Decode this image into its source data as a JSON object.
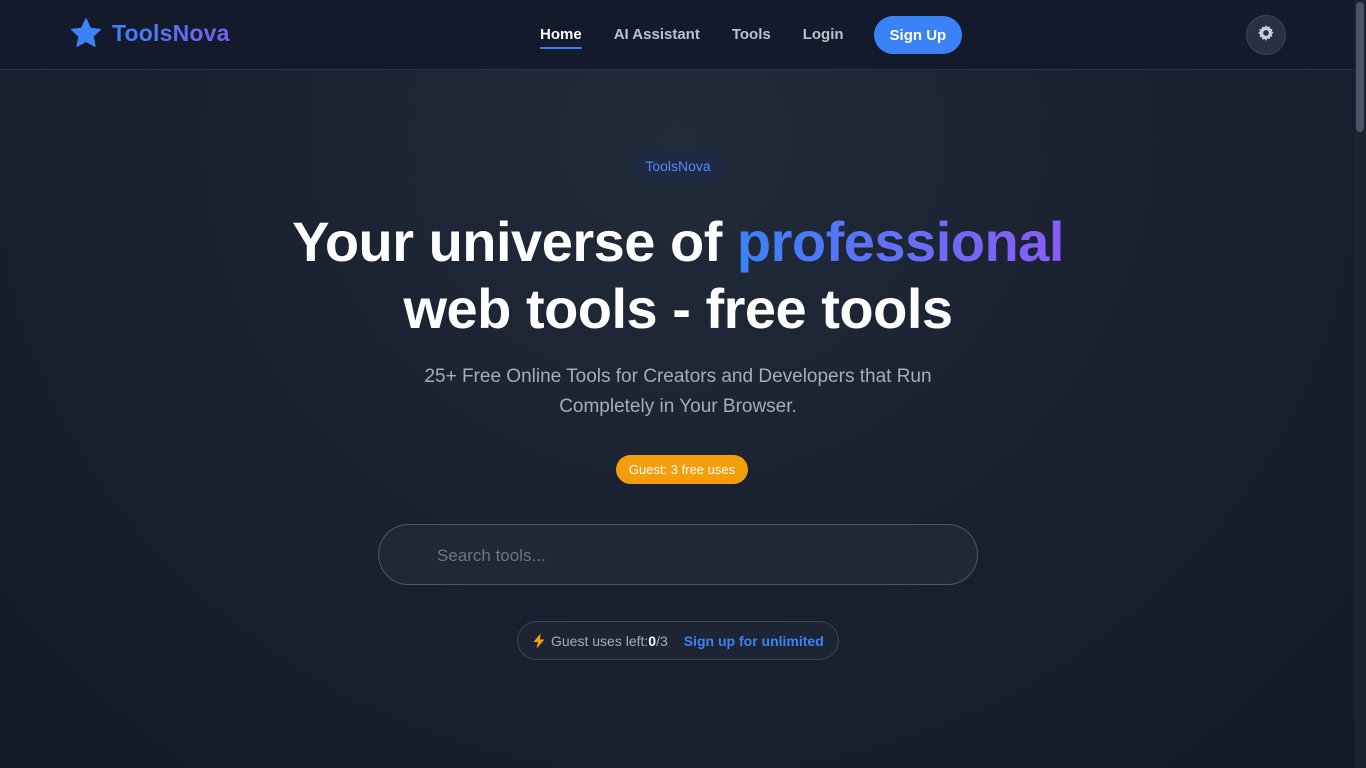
{
  "brand": {
    "name": "ToolsNova",
    "logo_icon": "star-icon",
    "gradient_start": "#3b82f6",
    "gradient_end": "#8b5cf6"
  },
  "nav": {
    "items": [
      {
        "label": "Home",
        "active": true
      },
      {
        "label": "AI Assistant",
        "active": false
      },
      {
        "label": "Tools",
        "active": false
      },
      {
        "label": "Login",
        "active": false
      }
    ],
    "signup_label": "Sign Up",
    "theme_toggle_icon": "gear-icon"
  },
  "hero": {
    "badge": "ToolsNova",
    "title_part1": "Your universe of ",
    "title_accent": "professional",
    "title_part2": "web tools - free tools",
    "subtitle": "25+ Free Online Tools for Creators and Developers that Run Completely in Your Browser.",
    "guest_pill": "Guest: 3 free uses"
  },
  "search": {
    "placeholder": "Search tools...",
    "value": ""
  },
  "usage": {
    "icon": "lightning-icon",
    "label": "Guest uses left: ",
    "used": "0",
    "limit": "/3",
    "link_label": "Sign up for unlimited"
  },
  "colors": {
    "accent": "#3b82f6",
    "warning": "#f59e0b",
    "background": "#111827"
  }
}
